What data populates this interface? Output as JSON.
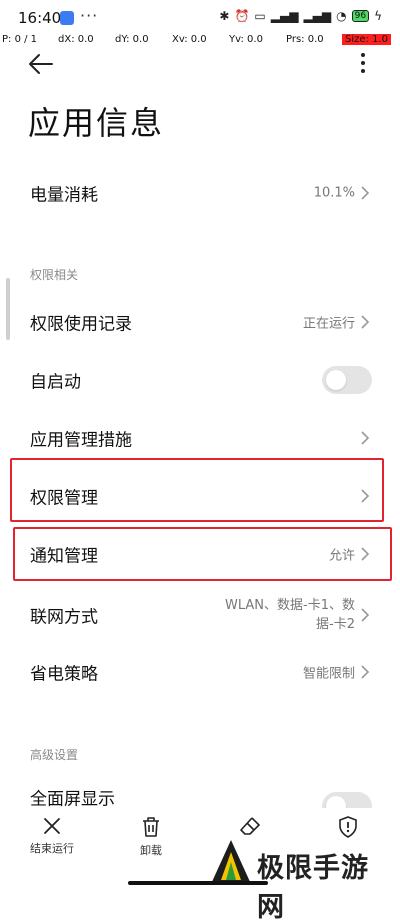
{
  "status_bar": {
    "time": "16:40",
    "dots": "···",
    "battery": "96"
  },
  "debug": {
    "p": "P: 0 / 1",
    "dx": "dX: 0.0",
    "dy": "dY: 0.0",
    "xv": "Xv: 0.0",
    "yv": "Yv: 0.0",
    "prs": "Prs: 0.0",
    "size": "Size: 1.0"
  },
  "header": {
    "title": "应用信息"
  },
  "rows": {
    "battery_usage": {
      "label": "电量消耗",
      "value": "10.1%"
    },
    "perm_section": "权限相关",
    "perm_records": {
      "label": "权限使用记录",
      "value": "正在运行"
    },
    "autostart": {
      "label": "自启动"
    },
    "app_measures": {
      "label": "应用管理措施"
    },
    "perm_manage": {
      "label": "权限管理"
    },
    "notif_manage": {
      "label": "通知管理",
      "value": "允许"
    },
    "network": {
      "label": "联网方式",
      "value_line1": "WLAN、数据-卡1、数",
      "value_line2": "据-卡2"
    },
    "power_strategy": {
      "label": "省电策略",
      "value": "智能限制"
    },
    "advanced_section": "高级设置",
    "fullscreen": {
      "label": "全面屏显示"
    }
  },
  "bottom_bar": {
    "stop": "结束运行",
    "uninstall": "卸载",
    "clear": "",
    "security": ""
  },
  "watermark": {
    "text": "极限手游网"
  },
  "colors": {
    "highlight": "#e3232f",
    "toggle_off": "#e4e4e4",
    "secondary_text": "#777777"
  }
}
